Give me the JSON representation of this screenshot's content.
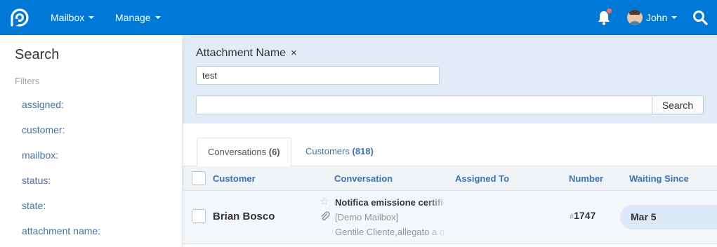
{
  "nav": {
    "mailbox_label": "Mailbox",
    "manage_label": "Manage",
    "user_name": "John",
    "brand_color": "#0078d7",
    "notification_dot_color": "#ff6b5b"
  },
  "sidebar": {
    "title": "Search",
    "filters_label": "Filters",
    "filters": [
      {
        "label": "assigned:"
      },
      {
        "label": "customer:"
      },
      {
        "label": "mailbox:"
      },
      {
        "label": "status:"
      },
      {
        "label": "state:"
      },
      {
        "label": "attachment name:"
      }
    ]
  },
  "search": {
    "attachment_filter_label": "Attachment Name",
    "remove_glyph": "×",
    "attachment_value": "test",
    "query_value": "",
    "button_label": "Search"
  },
  "tabs": [
    {
      "label": "Conversations",
      "count": "(6)",
      "active": true
    },
    {
      "label": "Customers",
      "count": "(818)",
      "active": false
    }
  ],
  "table": {
    "columns": [
      "Customer",
      "Conversation",
      "Assigned To",
      "Number",
      "Waiting Since"
    ],
    "rows": [
      {
        "customer": "Brian Bosco",
        "subject": "Notifica emissione certificato",
        "mailbox": "[Demo Mailbox]",
        "preview": "Gentile Cliente,allegato a questa mail",
        "assigned_to": "",
        "number_hash": "#",
        "number": "1747",
        "waiting_since": "Mar 5",
        "has_attachment": true,
        "starred": false
      }
    ]
  },
  "icons": {
    "logo": "logo-icon",
    "notification": "bell-icon",
    "search": "search-icon",
    "star": "star-icon",
    "attachment": "paperclip-icon"
  }
}
